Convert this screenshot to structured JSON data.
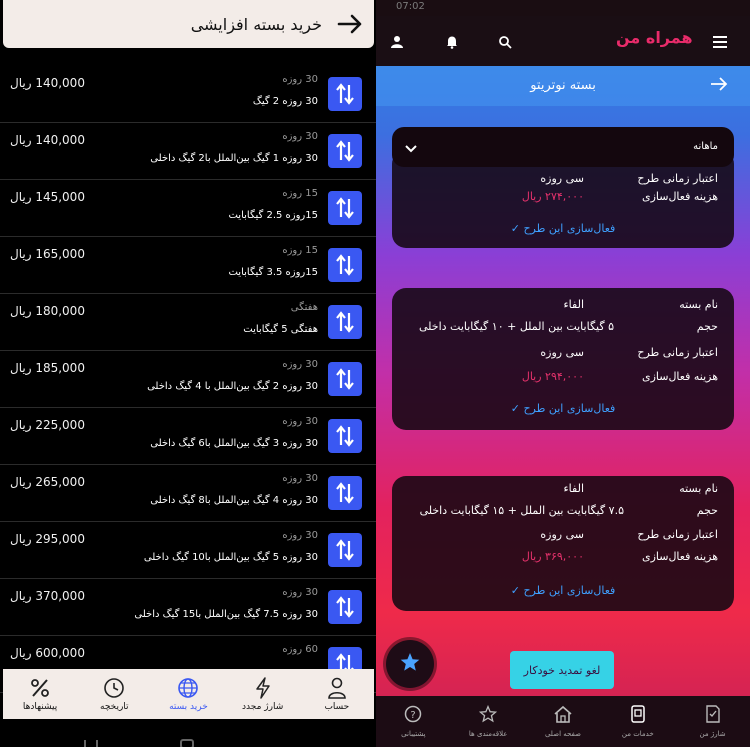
{
  "left": {
    "header_title": "خرید بسته افزایشی",
    "rows": [
      {
        "price": "140,000 ریال",
        "duration": "30 روزه",
        "name": "30 روزه 2 گیگ"
      },
      {
        "price": "140,000 ریال",
        "duration": "30 روزه",
        "name": "30 روزه 1 گیگ بین‌الملل با2 گیگ داخلی"
      },
      {
        "price": "145,000 ریال",
        "duration": "15 روزه",
        "name": "15روزه 2.5 گیگابایت"
      },
      {
        "price": "165,000 ریال",
        "duration": "15 روزه",
        "name": "15روزه 3.5 گیگابایت"
      },
      {
        "price": "180,000 ریال",
        "duration": "هفتگی",
        "name": "هفتگی 5 گیگابایت"
      },
      {
        "price": "185,000 ریال",
        "duration": "30 روزه",
        "name": "30 روزه 2 گیگ بین‌الملل با 4 گیگ داخلی"
      },
      {
        "price": "225,000 ریال",
        "duration": "30 روزه",
        "name": "30 روزه 3 گیگ بین‌الملل با6 گیگ داخلی"
      },
      {
        "price": "265,000 ریال",
        "duration": "30 روزه",
        "name": "30 روزه 4 گیگ بین‌الملل با8 گیگ داخلی"
      },
      {
        "price": "295,000 ریال",
        "duration": "30 روزه",
        "name": "30 روزه 5 گیگ بین‌الملل با10 گیگ داخلی"
      },
      {
        "price": "370,000 ریال",
        "duration": "30 روزه",
        "name": "30 روزه 7.5 گیگ بین‌الملل با15 گیگ داخلی"
      },
      {
        "price": "600,000 ریال",
        "duration": "60 روزه",
        "name": ""
      }
    ],
    "nav": [
      {
        "label": "حساب",
        "icon": "person-icon"
      },
      {
        "label": "شارژ مجدد",
        "icon": "lightning-icon"
      },
      {
        "label": "خرید بسته",
        "icon": "globe-icon",
        "active": true
      },
      {
        "label": "تاریخچه",
        "icon": "clock-icon"
      },
      {
        "label": "پیشنهادها",
        "icon": "percent-icon"
      }
    ]
  },
  "right": {
    "status_time": "07:02",
    "logo_text": "همراه من",
    "sub_title": "بسته نوتریتو",
    "dropdown_value": "ماهانه",
    "card1": {
      "validity_label": "اعتبار زمانی طرح",
      "validity_value": "سی روزه",
      "cost_label": "هزینه فعال‌سازی",
      "cost_value": "۲۷۴,۰۰۰ ریال",
      "action": "فعال‌سازی این طرح"
    },
    "card2": {
      "name_label": "نام بسته",
      "name_value": "الفاء",
      "volume_label": "حجم",
      "volume_value": "۵ گیگابایت بین الملل + ۱۰ گیگابایت داخلی",
      "validity_label": "اعتبار زمانی طرح",
      "validity_value": "سی روزه",
      "cost_label": "هزینه فعال‌سازی",
      "cost_value": "۲۹۴,۰۰۰ ریال",
      "action": "فعال‌سازی این طرح"
    },
    "card3": {
      "name_label": "نام بسته",
      "name_value": "الفاء",
      "volume_label": "حجم",
      "volume_value": "۷.۵ گیگابایت بین الملل + ۱۵ گیگابایت داخلی",
      "validity_label": "اعتبار زمانی طرح",
      "validity_value": "سی روزه",
      "cost_label": "هزینه فعال‌سازی",
      "cost_value": "۳۶۹,۰۰۰ ریال",
      "action": "فعال‌سازی این طرح"
    },
    "auto_renew_label": "لغو تمدید خودکار",
    "nav": [
      {
        "label": "شارژ من",
        "icon": "sim-icon"
      },
      {
        "label": "خدمات من",
        "icon": "card-icon"
      },
      {
        "label": "صفحه اصلی",
        "icon": "home-icon"
      },
      {
        "label": "علاقه‌مندی ها",
        "icon": "star-icon"
      },
      {
        "label": "پشتیبانی",
        "icon": "help-icon"
      }
    ]
  },
  "colors": {
    "accent_blue": "#3a58f2",
    "brand_pink": "#e92b6a",
    "link_blue": "#3fa0ff",
    "cyan_button": "#36d2e6"
  }
}
